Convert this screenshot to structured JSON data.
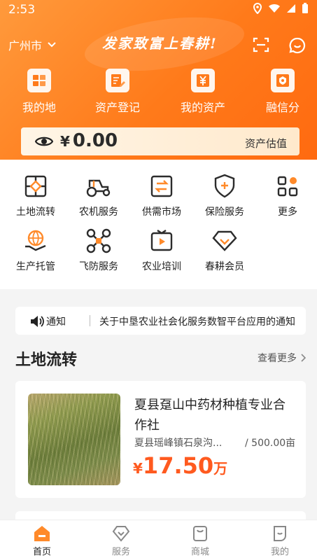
{
  "status_bar": {
    "time": "2:53"
  },
  "header": {
    "city": "广州市",
    "slogan": "发家致富上春耕!"
  },
  "quick_links": [
    {
      "label": "我的地",
      "icon": "land-icon"
    },
    {
      "label": "资产登记",
      "icon": "register-icon"
    },
    {
      "label": "我的资产",
      "icon": "yen-icon"
    },
    {
      "label": "融信分",
      "icon": "credit-icon"
    }
  ],
  "asset": {
    "currency": "¥",
    "amount": "0.00",
    "estimate_label": "资产估值"
  },
  "services": [
    {
      "label": "土地流转",
      "icon": "land-transfer-icon"
    },
    {
      "label": "农机服务",
      "icon": "tractor-icon"
    },
    {
      "label": "供需市场",
      "icon": "market-icon"
    },
    {
      "label": "保险服务",
      "icon": "shield-icon"
    },
    {
      "label": "更多",
      "icon": "more-grid-icon"
    },
    {
      "label": "生产托管",
      "icon": "hosting-icon"
    },
    {
      "label": "飞防服务",
      "icon": "drone-icon"
    },
    {
      "label": "农业培训",
      "icon": "training-icon"
    },
    {
      "label": "春耕会员",
      "icon": "member-icon"
    }
  ],
  "notice": {
    "label": "通知",
    "text": "关于中垦农业社会化服务数智平台应用的通知"
  },
  "land_section": {
    "title": "土地流转",
    "more_label": "查看更多"
  },
  "land_listing": {
    "title": "夏县趸山中药材种植专业合作社",
    "location": "夏县瑶峰镇石泉沟...",
    "area": "/ 500.00亩",
    "price_currency": "¥",
    "price_value": "17.50",
    "price_unit": "万"
  },
  "tabbar": [
    {
      "label": "首页",
      "icon": "home-icon",
      "active": true
    },
    {
      "label": "服务",
      "icon": "service-icon",
      "active": false
    },
    {
      "label": "商城",
      "icon": "mall-icon",
      "active": false
    },
    {
      "label": "我的",
      "icon": "profile-icon",
      "active": false
    }
  ],
  "colors": {
    "brand": "#ff7a1a",
    "price": "#ff5a1f",
    "icon": "#2c2c2c",
    "accent": "#ff8a2a"
  }
}
